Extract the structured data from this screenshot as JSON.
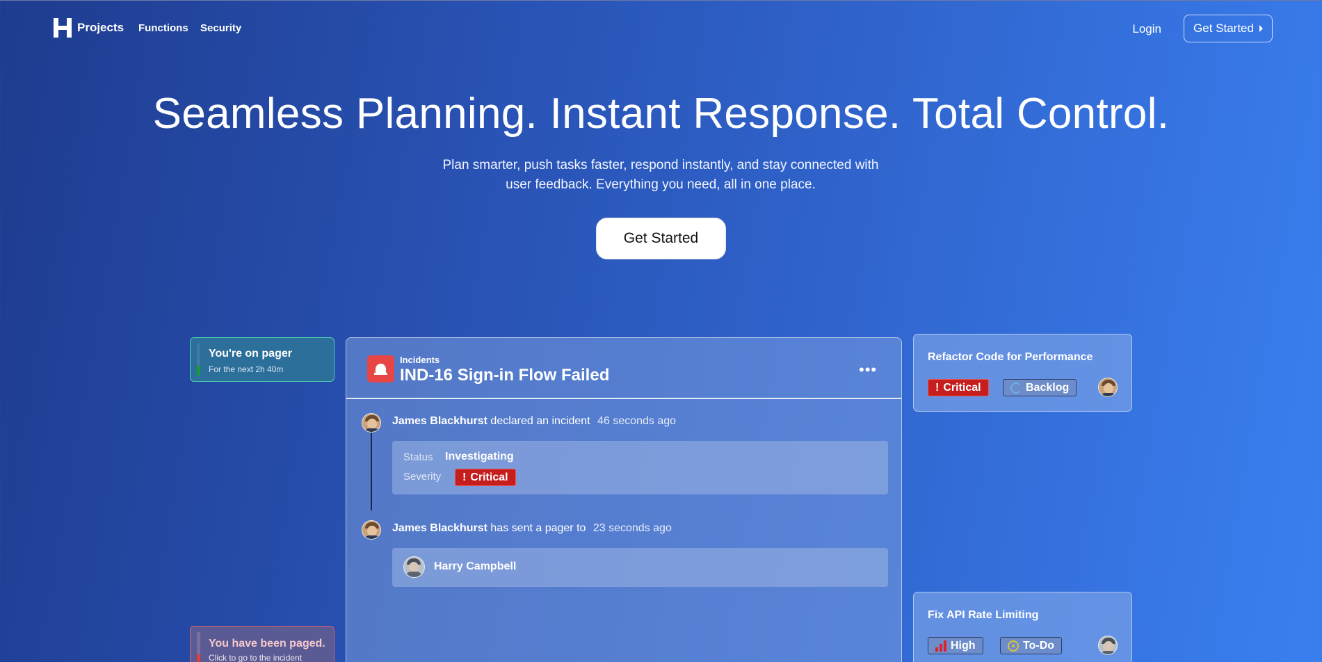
{
  "nav": {
    "brand": "Projects",
    "links": [
      "Functions",
      "Security"
    ],
    "login": "Login",
    "cta": "Get Started"
  },
  "hero": {
    "title": "Seamless Planning. Instant Response. Total Control.",
    "subtitle": "Plan smarter, push tasks faster, respond instantly, and stay connected with user feedback. Everything you need, all in one place.",
    "cta": "Get Started"
  },
  "pager_card": {
    "title": "You're on pager",
    "subtitle": "For the next 2h 40m"
  },
  "paged_card": {
    "title": "You have been paged.",
    "subtitle": "Click to go to the incident"
  },
  "incident": {
    "kicker": "Incidents",
    "title": "IND-16 Sign-in Flow Failed",
    "more": "•••",
    "events": [
      {
        "actor": "James Blackhurst",
        "action": "declared an incident",
        "ago": "46 seconds ago"
      },
      {
        "actor": "James Blackhurst",
        "action": "has sent a pager to",
        "ago": "23 seconds ago"
      }
    ],
    "status_label": "Status",
    "status_value": "Investigating",
    "severity_label": "Severity",
    "severity_value": "Critical",
    "paged_user": "Harry Campbell"
  },
  "tasks": [
    {
      "title": "Refactor Code for Performance",
      "priority": "Critical",
      "state": "Backlog"
    },
    {
      "title": "Fix API Rate Limiting",
      "priority": "High",
      "state": "To-Do"
    }
  ],
  "icons": {
    "bang": "!",
    "priority_colors": {
      "critical": "#c61d1d",
      "high": "#e0212a"
    }
  }
}
